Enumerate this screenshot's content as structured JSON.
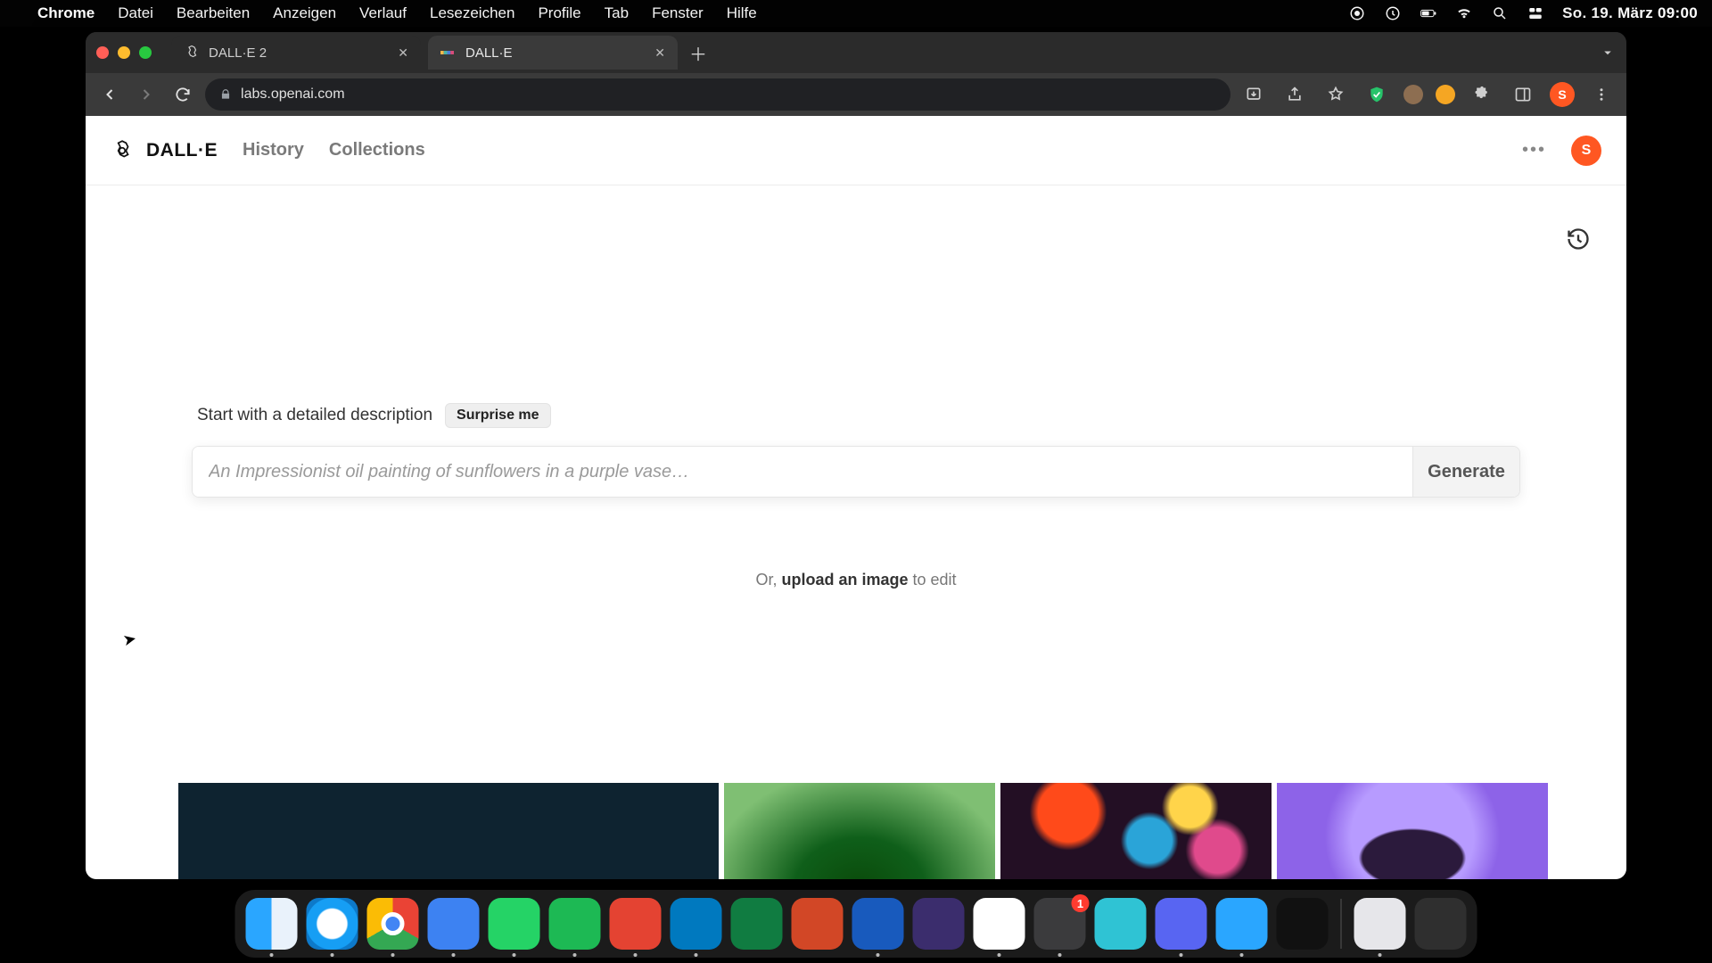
{
  "menubar": {
    "app": "Chrome",
    "items": [
      "Datei",
      "Bearbeiten",
      "Anzeigen",
      "Verlauf",
      "Lesezeichen",
      "Profile",
      "Tab",
      "Fenster",
      "Hilfe"
    ],
    "clock": "So. 19. März  09:00"
  },
  "browser": {
    "tabs": [
      {
        "favicon": "openai-logo",
        "title": "DALL·E 2",
        "active": false
      },
      {
        "favicon": "dalle-logo",
        "title": "DALL·E",
        "active": true
      }
    ],
    "url": "labs.openai.com",
    "avatar_initial": "S"
  },
  "app": {
    "brand": "DALL·E",
    "nav": [
      "History",
      "Collections"
    ],
    "avatar_initial": "S"
  },
  "prompt": {
    "hint": "Start with a detailed description",
    "surprise": "Surprise me",
    "placeholder": "An Impressionist oil painting of sunflowers in a purple vase…",
    "generate": "Generate",
    "or_prefix": "Or, ",
    "upload": "upload an image",
    "or_suffix": " to edit"
  },
  "dock": {
    "apps": [
      {
        "name": "finder",
        "running": true
      },
      {
        "name": "safari",
        "running": true
      },
      {
        "name": "chrome",
        "running": true
      },
      {
        "name": "zoom",
        "running": true
      },
      {
        "name": "whatsapp",
        "running": true
      },
      {
        "name": "spotify",
        "running": true
      },
      {
        "name": "todoist",
        "running": true
      },
      {
        "name": "trello",
        "running": true
      },
      {
        "name": "excel",
        "running": false
      },
      {
        "name": "powerpoint",
        "running": false
      },
      {
        "name": "word",
        "running": true
      },
      {
        "name": "imovie",
        "running": false
      },
      {
        "name": "google-drive",
        "running": true
      },
      {
        "name": "settings",
        "running": true,
        "badge": "1"
      },
      {
        "name": "circle-app",
        "running": false
      },
      {
        "name": "discord",
        "running": true
      },
      {
        "name": "quicktime",
        "running": true
      },
      {
        "name": "voice-memos",
        "running": false
      }
    ],
    "right": [
      {
        "name": "preview",
        "running": true
      },
      {
        "name": "trash",
        "running": false
      }
    ]
  }
}
